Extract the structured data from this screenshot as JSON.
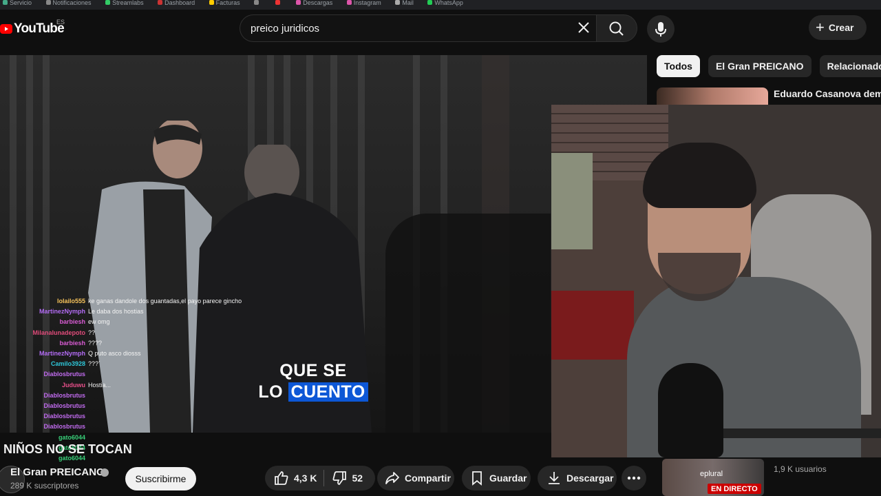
{
  "masthead": {
    "logo_text": "YouTube",
    "country_code": "ES",
    "search_value": "preico juridicos",
    "create_label": "Crear"
  },
  "chips": [
    "Todos",
    "El Gran PREICANO",
    "Relacionados"
  ],
  "recommendation": {
    "title": "Eduardo Casanova deman"
  },
  "player": {
    "caption_line1": "QUE SE",
    "caption_line2a": "LO ",
    "caption_line2b": "CUENTO"
  },
  "chat": [
    {
      "user": "loIailo555",
      "msg": "ke ganas dandole dos guantadas,el payo parece gincho",
      "color": "#f6c25a"
    },
    {
      "user": "MartinezNymph",
      "msg": "Le daba dos hostias",
      "color": "#b36cf5"
    },
    {
      "user": "barbiesh",
      "msg": "ew omg",
      "color": "#d95bd4"
    },
    {
      "user": "Milanalunadepoto",
      "msg": "??",
      "color": "#e04b7a"
    },
    {
      "user": "barbiesh",
      "msg": "????",
      "color": "#d95bd4"
    },
    {
      "user": "MartinezNymph",
      "msg": "Q puto asco diosss",
      "color": "#b36cf5"
    },
    {
      "user": "Camilo3928",
      "msg": "???´",
      "color": "#2ec7d9"
    },
    {
      "user": "Diablosbrutus",
      "msg": "",
      "color": "#c26cf0"
    },
    {
      "user": "Juduwu",
      "msg": "Hostia...",
      "color": "#e84f8a"
    },
    {
      "user": "Diablosbrutus",
      "msg": "",
      "color": "#c26cf0"
    },
    {
      "user": "Diablosbrutus",
      "msg": "",
      "color": "#c26cf0"
    },
    {
      "user": "Diablosbrutus",
      "msg": "",
      "color": "#c26cf0"
    },
    {
      "user": "Diablosbrutus",
      "msg": "",
      "color": "#c26cf0"
    },
    {
      "user": "gato6044",
      "msg": "",
      "color": "#39d17a"
    },
    {
      "user": "gato6044",
      "msg": "",
      "color": "#39d17a"
    },
    {
      "user": "gato6044",
      "msg": "",
      "color": "#39d17a"
    }
  ],
  "video": {
    "title": "NIÑOS NO SE TOCAN",
    "channel": "El Gran PREICANO",
    "subscribers": "289 K suscriptores",
    "subscribe_label": "Suscribirme",
    "likes": "4,3 K",
    "dislikes": "52",
    "share_label": "Compartir",
    "save_label": "Guardar",
    "download_label": "Descargar"
  },
  "live": {
    "label": "eplural",
    "badge": "EN DIRECTO",
    "users": "1,9 K usuarios"
  }
}
